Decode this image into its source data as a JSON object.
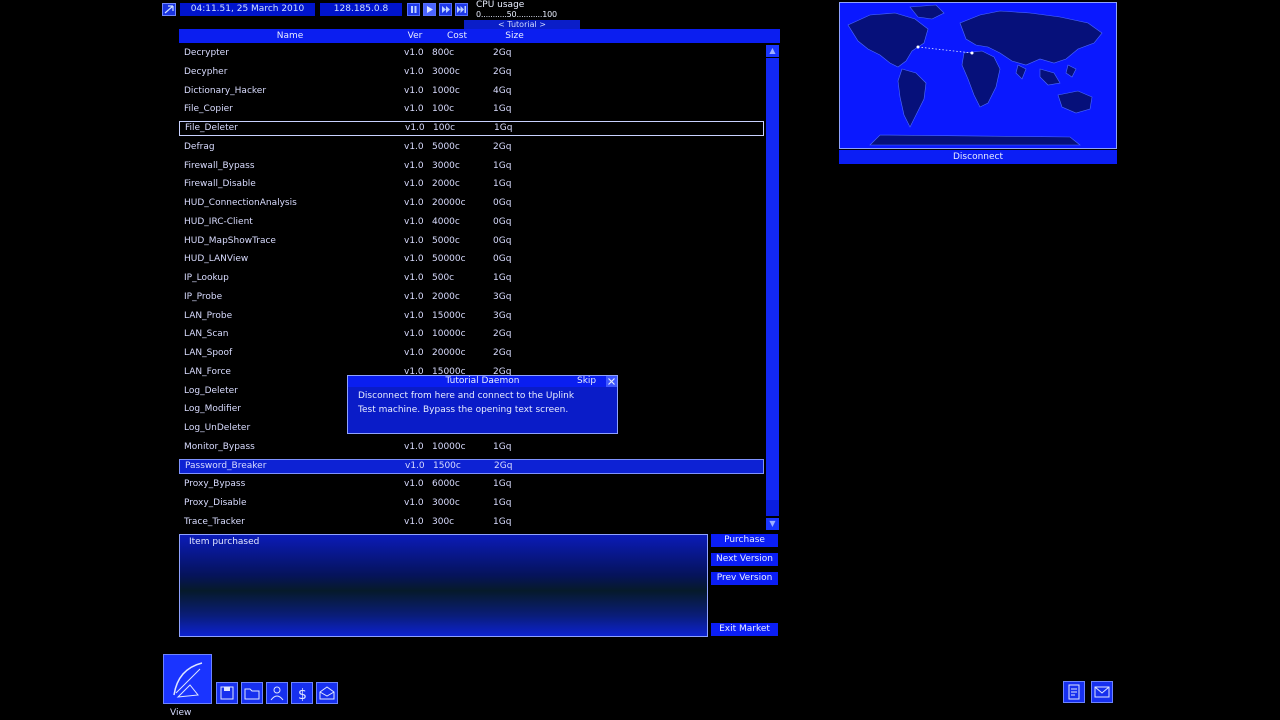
{
  "topbar": {
    "menu_icon": "menu-icon",
    "datetime": "04:11.51, 25 March 2010",
    "ip": "128.185.0.8",
    "speed_controls": [
      "pause-icon",
      "play-icon",
      "fast-forward-icon",
      "fastest-icon"
    ],
    "cpu_title": "CPU usage",
    "cpu_scale": "0...........50...........100",
    "tutorial_label": "< Tutorial >"
  },
  "table": {
    "columns": {
      "name": "Name",
      "ver": "Ver",
      "cost": "Cost",
      "size": "Size"
    },
    "rows": [
      {
        "name": "Decrypter",
        "ver": "v1.0",
        "cost": "800c",
        "size": "2Gq"
      },
      {
        "name": "Decypher",
        "ver": "v1.0",
        "cost": "3000c",
        "size": "2Gq"
      },
      {
        "name": "Dictionary_Hacker",
        "ver": "v1.0",
        "cost": "1000c",
        "size": "4Gq"
      },
      {
        "name": "File_Copier",
        "ver": "v1.0",
        "cost": "100c",
        "size": "1Gq"
      },
      {
        "name": "File_Deleter",
        "ver": "v1.0",
        "cost": "100c",
        "size": "1Gq"
      },
      {
        "name": "Defrag",
        "ver": "v1.0",
        "cost": "5000c",
        "size": "2Gq"
      },
      {
        "name": "Firewall_Bypass",
        "ver": "v1.0",
        "cost": "3000c",
        "size": "1Gq"
      },
      {
        "name": "Firewall_Disable",
        "ver": "v1.0",
        "cost": "2000c",
        "size": "1Gq"
      },
      {
        "name": "HUD_ConnectionAnalysis",
        "ver": "v1.0",
        "cost": "20000c",
        "size": "0Gq"
      },
      {
        "name": "HUD_IRC-Client",
        "ver": "v1.0",
        "cost": "4000c",
        "size": "0Gq"
      },
      {
        "name": "HUD_MapShowTrace",
        "ver": "v1.0",
        "cost": "5000c",
        "size": "0Gq"
      },
      {
        "name": "HUD_LANView",
        "ver": "v1.0",
        "cost": "50000c",
        "size": "0Gq"
      },
      {
        "name": "IP_Lookup",
        "ver": "v1.0",
        "cost": "500c",
        "size": "1Gq"
      },
      {
        "name": "IP_Probe",
        "ver": "v1.0",
        "cost": "2000c",
        "size": "3Gq"
      },
      {
        "name": "LAN_Probe",
        "ver": "v1.0",
        "cost": "15000c",
        "size": "3Gq"
      },
      {
        "name": "LAN_Scan",
        "ver": "v1.0",
        "cost": "10000c",
        "size": "2Gq"
      },
      {
        "name": "LAN_Spoof",
        "ver": "v1.0",
        "cost": "20000c",
        "size": "2Gq"
      },
      {
        "name": "LAN_Force",
        "ver": "v1.0",
        "cost": "15000c",
        "size": "2Gq"
      },
      {
        "name": "Log_Deleter",
        "ver": "",
        "cost": "",
        "size": ""
      },
      {
        "name": "Log_Modifier",
        "ver": "",
        "cost": "",
        "size": ""
      },
      {
        "name": "Log_UnDeleter",
        "ver": "",
        "cost": "",
        "size": ""
      },
      {
        "name": "Monitor_Bypass",
        "ver": "v1.0",
        "cost": "10000c",
        "size": "1Gq"
      },
      {
        "name": "Password_Breaker",
        "ver": "v1.0",
        "cost": "1500c",
        "size": "2Gq"
      },
      {
        "name": "Proxy_Bypass",
        "ver": "v1.0",
        "cost": "6000c",
        "size": "1Gq"
      },
      {
        "name": "Proxy_Disable",
        "ver": "v1.0",
        "cost": "3000c",
        "size": "1Gq"
      },
      {
        "name": "Trace_Tracker",
        "ver": "v1.0",
        "cost": "300c",
        "size": "1Gq"
      }
    ]
  },
  "message": {
    "text": "Item purchased"
  },
  "actions": {
    "purchase": "Purchase",
    "next_version": "Next Version",
    "prev_version": "Prev Version",
    "exit_market": "Exit Market"
  },
  "map": {
    "disconnect": "Disconnect"
  },
  "tutorial_popup": {
    "title": "Tutorial Daemon",
    "skip": "Skip",
    "line1": "Disconnect from here and connect to the Uplink",
    "line2": "Test machine.  Bypass the opening text screen."
  },
  "toolbar": {
    "view_label": "View",
    "tools": [
      "save-icon",
      "folder-icon",
      "person-icon",
      "dollar-icon",
      "mail-open-icon"
    ],
    "right_tools": [
      "notes-icon",
      "email-icon"
    ]
  },
  "colors": {
    "accent": "#0a1eff",
    "background": "#000000"
  }
}
